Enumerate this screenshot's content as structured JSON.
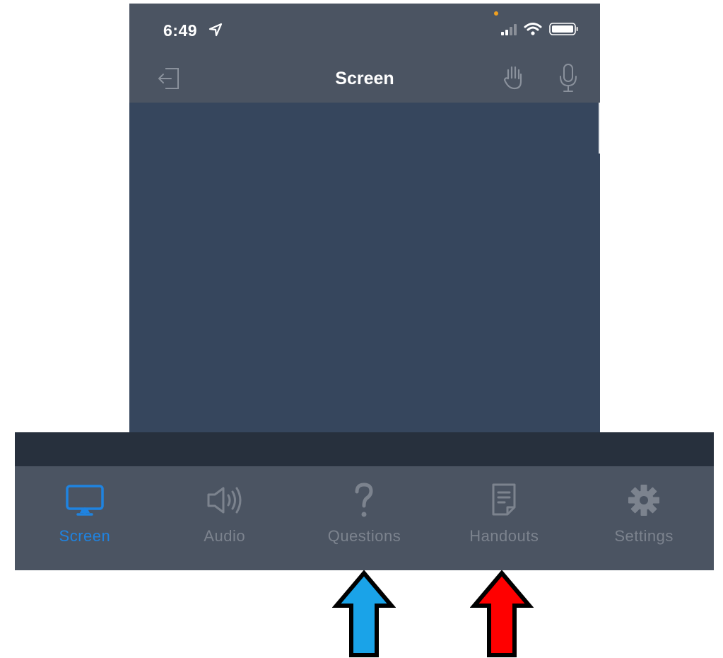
{
  "status_bar": {
    "time": "6:49",
    "icons": [
      "location-arrow-icon",
      "cellular-signal-icon",
      "wifi-icon",
      "battery-icon"
    ]
  },
  "nav_bar": {
    "title": "Screen",
    "icons": [
      "exit-icon",
      "raise-hand-icon",
      "microphone-icon"
    ]
  },
  "tabs": [
    {
      "label": "Screen",
      "icon": "monitor-icon",
      "active": true
    },
    {
      "label": "Audio",
      "icon": "speaker-icon",
      "active": false
    },
    {
      "label": "Questions",
      "icon": "question-icon",
      "active": false
    },
    {
      "label": "Handouts",
      "icon": "document-icon",
      "active": false
    },
    {
      "label": "Settings",
      "icon": "gear-icon",
      "active": false
    }
  ],
  "annotations": [
    {
      "name": "blue-arrow",
      "points_to": "Questions",
      "color": "#1aa3e8"
    },
    {
      "name": "red-arrow",
      "points_to": "Handouts",
      "color": "#ff0000"
    }
  ],
  "colors": {
    "accent": "#1f83e0",
    "inactive": "#7c838e",
    "screen_background": "#36465d",
    "bar_background": "#4b5462"
  }
}
